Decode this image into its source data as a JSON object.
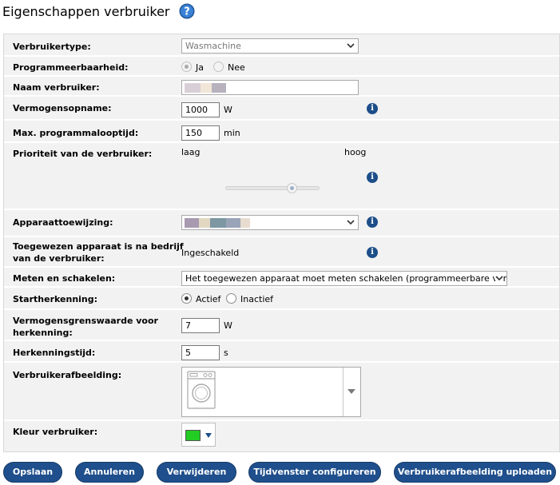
{
  "page": {
    "title": "Eigenschappen verbruiker"
  },
  "rows": {
    "type": {
      "label": "Verbruikertype:",
      "value": "Wasmachine"
    },
    "programmable": {
      "label": "Programmeerbaarheid:",
      "options": [
        "Ja",
        "Nee"
      ],
      "selected": "Ja"
    },
    "name": {
      "label": "Naam verbruiker:"
    },
    "power": {
      "label": "Vermogensopname:",
      "value": "1000",
      "unit": "W"
    },
    "runtime": {
      "label": "Max. programmalooptijd:",
      "value": "150",
      "unit": "min"
    },
    "priority": {
      "label": "Prioriteit van de verbruiker:",
      "low": "laag",
      "high": "hoog",
      "level": 0.73
    },
    "device": {
      "label": "Apparaattoewijzing:"
    },
    "operation": {
      "label_line1": "Toegewezen apparaat is na bedrijf",
      "label_line2": "van de verbruiker:",
      "value": "Ingeschakeld"
    },
    "measure": {
      "label": "Meten en schakelen:",
      "value": "Het toegewezen apparaat moet meten schakelen (programmeerbare vermogen"
    },
    "start": {
      "label": "Startherkenning:",
      "options": [
        "Actief",
        "Inactief"
      ],
      "selected": "Actief"
    },
    "threshold": {
      "label_line1": "Vermogensgrenswaarde voor",
      "label_line2": "herkenning:",
      "value": "7",
      "unit": "W"
    },
    "recog_time": {
      "label": "Herkenningstijd:",
      "value": "5",
      "unit": "s"
    },
    "image": {
      "label": "Verbruikerafbeelding:",
      "icon": "washing-machine-icon"
    },
    "color": {
      "label": "Kleur verbruiker:",
      "value": "#22cc22"
    }
  },
  "buttons": {
    "save": "Opslaan",
    "cancel": "Annuleren",
    "delete": "Verwijderen",
    "timewindow": "Tijdvenster configureren",
    "upload": "Verbruikerafbeelding uploaden"
  },
  "colors": {
    "button": "#1f4f8c",
    "info": "#1d4e89",
    "form_bg": "#f2f2f2"
  }
}
